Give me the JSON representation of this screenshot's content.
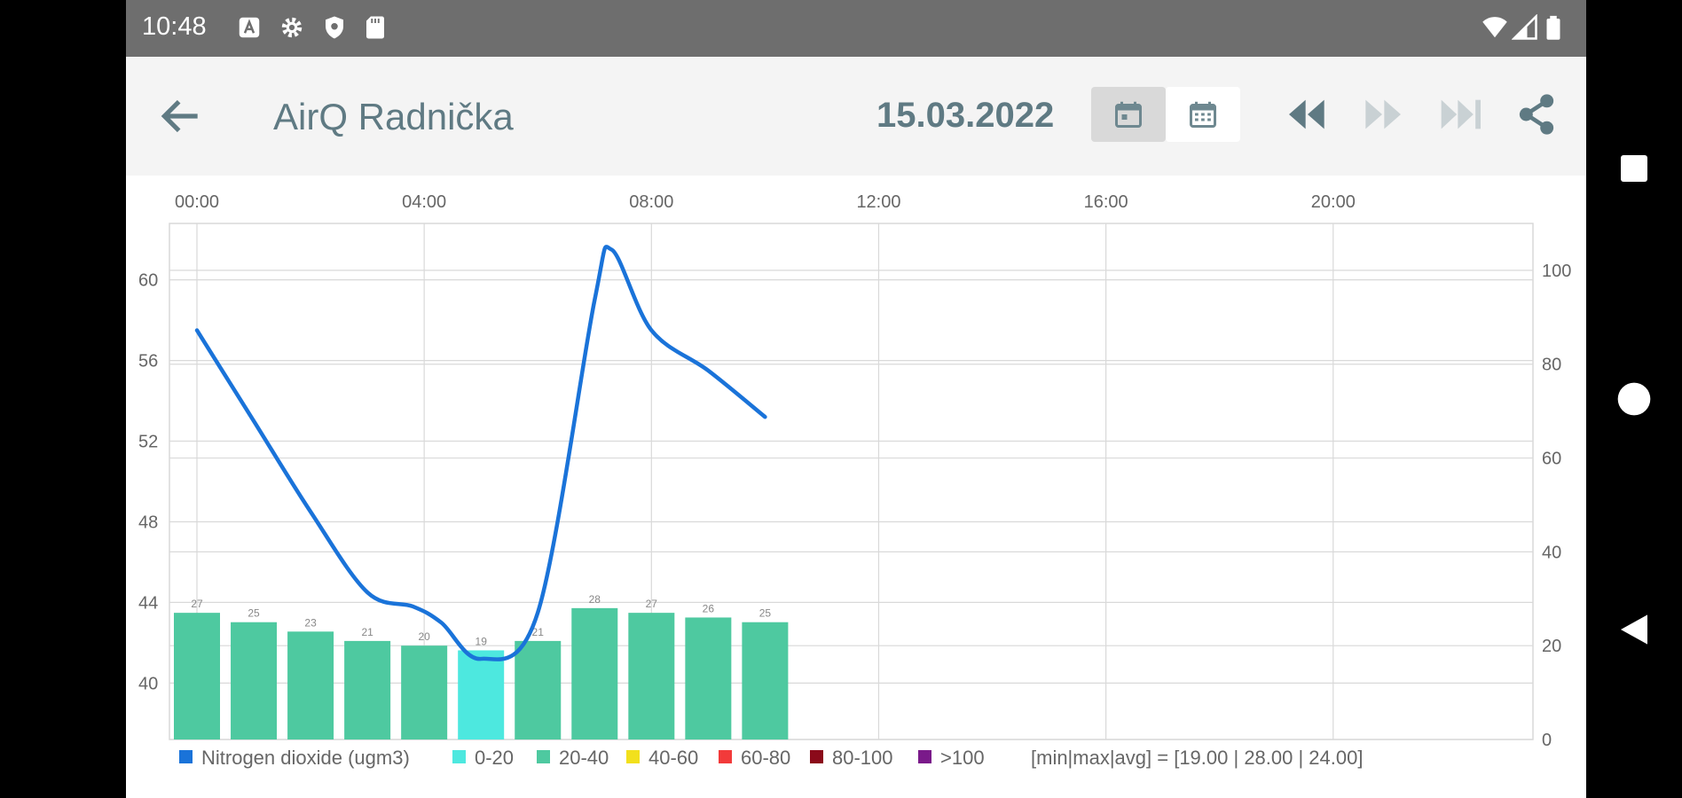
{
  "status_bar": {
    "time": "10:48",
    "left_icons": [
      "a-notification-icon",
      "gear-icon",
      "shield-icon",
      "sd-card-icon"
    ],
    "right_icons": [
      "wifi-icon",
      "signal-icon",
      "battery-icon"
    ]
  },
  "app_bar": {
    "title": "AirQ Radnička",
    "date": "15.03.2022",
    "back_icon": "arrow-left-icon",
    "view_buttons": [
      {
        "name": "day-view",
        "icon": "calendar-day-icon",
        "selected": true
      },
      {
        "name": "month-view",
        "icon": "calendar-month-icon",
        "selected": false
      }
    ],
    "nav_buttons": [
      {
        "name": "previous",
        "icon": "rewind-icon",
        "enabled": true
      },
      {
        "name": "next",
        "icon": "fast-forward-icon",
        "enabled": false
      },
      {
        "name": "last",
        "icon": "skip-to-end-icon",
        "enabled": false
      },
      {
        "name": "share",
        "icon": "share-icon",
        "enabled": true
      }
    ],
    "text_color": "#5f7a83"
  },
  "chart_data": {
    "type": "bar",
    "x_ticks": [
      "00:00",
      "04:00",
      "08:00",
      "12:00",
      "16:00",
      "20:00"
    ],
    "left_axis": {
      "ticks": [
        40,
        44,
        48,
        52,
        56,
        60
      ],
      "range": [
        37.2,
        62.8
      ]
    },
    "right_axis": {
      "ticks": [
        0,
        20,
        40,
        60,
        80,
        100
      ],
      "range": [
        0,
        110
      ]
    },
    "bars": {
      "hours": [
        0,
        1,
        2,
        3,
        4,
        5,
        6,
        7,
        8,
        9,
        10
      ],
      "values": [
        27,
        25,
        23,
        21,
        20,
        19,
        21,
        28,
        27,
        26,
        25
      ],
      "labels": [
        "27",
        "25",
        "23",
        "21",
        "20",
        "19",
        "21",
        "28",
        "27",
        "26",
        "25"
      ]
    },
    "line": {
      "name": "Nitrogen dioxide (ugm3)",
      "hours": [
        0,
        1,
        2,
        3,
        3.8,
        4.3,
        5,
        6,
        7,
        7.3,
        8,
        9,
        10
      ],
      "values": [
        57.5,
        53,
        48.5,
        44.5,
        43.8,
        43,
        41.2,
        43.5,
        59,
        61.5,
        57.5,
        55.5,
        53.2
      ]
    },
    "legend": [
      {
        "label": "Nitrogen dioxide (ugm3)",
        "color": "#1a73d9"
      },
      {
        "label": "0-20",
        "color": "#4de8df"
      },
      {
        "label": "20-40",
        "color": "#4ec9a0"
      },
      {
        "label": "40-60",
        "color": "#f2e01c"
      },
      {
        "label": "60-80",
        "color": "#f23a3a"
      },
      {
        "label": "80-100",
        "color": "#8b0a1a"
      },
      {
        "label": ">100",
        "color": "#7a1a8a"
      }
    ],
    "summary": "[min|max|avg] = [19.00 | 28.00 | 24.00]",
    "grid": true,
    "colors": {
      "line": "#1a73d9",
      "bar_low": "#4de8df",
      "bar_mid": "#4ec9a0",
      "grid": "#d9d9d9",
      "text": "#666666"
    }
  }
}
